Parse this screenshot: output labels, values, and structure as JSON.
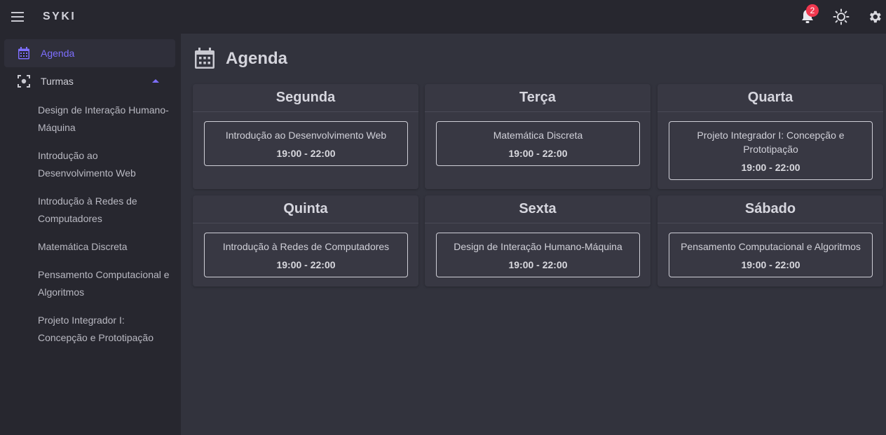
{
  "app": {
    "brand": "SYKI"
  },
  "appbar": {
    "notifications_count": "2",
    "icons": [
      "menu-icon",
      "bell-icon",
      "sun-icon",
      "gear-icon"
    ],
    "badge_color": "#f0384f"
  },
  "sidebar": {
    "agenda_label": "Agenda",
    "turmas_label": "Turmas",
    "turmas": [
      "Design de Interação Humano-Máquina",
      "Introdução ao Desenvolvimento Web",
      "Introdução à Redes de Computadores",
      "Matemática Discreta",
      "Pensamento Computacional e Algoritmos",
      "Projeto Integrador I: Concepção e Prototipação"
    ],
    "accent_color": "#7e6fff"
  },
  "page": {
    "title": "Agenda"
  },
  "days": [
    {
      "name": "Segunda",
      "class": "Introdução ao Desenvolvimento Web",
      "time": "19:00 - 22:00"
    },
    {
      "name": "Terça",
      "class": "Matemática Discreta",
      "time": "19:00 - 22:00"
    },
    {
      "name": "Quarta",
      "class": "Projeto Integrador I: Concepção e Prototipação",
      "time": "19:00 - 22:00"
    },
    {
      "name": "Quinta",
      "class": "Introdução à Redes de Computadores",
      "time": "19:00 - 22:00"
    },
    {
      "name": "Sexta",
      "class": "Design de Interação Humano-Máquina",
      "time": "19:00 - 22:00"
    },
    {
      "name": "Sábado",
      "class": "Pensamento Computacional e Algoritmos",
      "time": "19:00 - 22:00"
    }
  ]
}
